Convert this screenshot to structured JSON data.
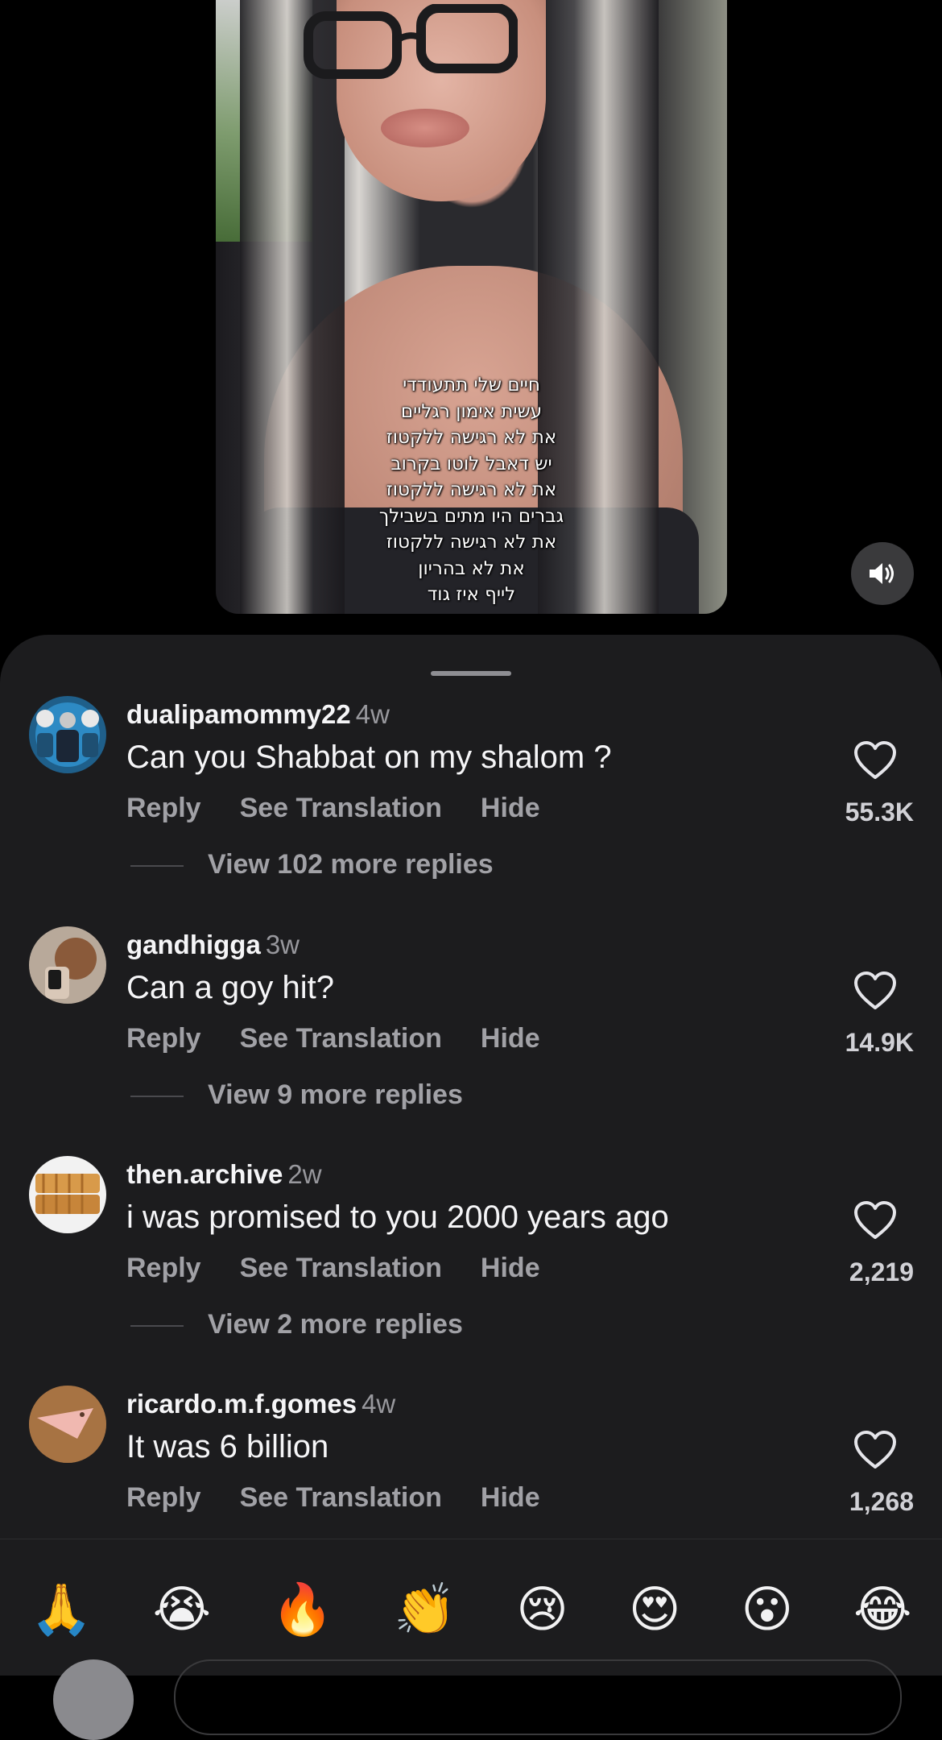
{
  "video": {
    "overlay_lines": [
      "חיים שלי תתעודדי",
      "עשית אימון רגליים",
      "את לא רגישה ללקטוז",
      "יש דאבל לוטו בקרוב",
      "את לא רגישה ללקטוז",
      "גברים היו מתים בשבילך",
      "את לא רגישה ללקטוז",
      "את לא בהריון",
      "לייף איז גוד"
    ],
    "sound_icon": "speaker-on-icon"
  },
  "comments": [
    {
      "username": "dualipamommy22",
      "age": "4w",
      "text": "Can you Shabbat on my shalom ?",
      "reply_label": "Reply",
      "translate_label": "See Translation",
      "hide_label": "Hide",
      "likes": "55.3K",
      "view_more": "View 102 more replies"
    },
    {
      "username": "gandhigga",
      "age": "3w",
      "text": "Can a goy hit?",
      "reply_label": "Reply",
      "translate_label": "See Translation",
      "hide_label": "Hide",
      "likes": "14.9K",
      "view_more": "View 9 more replies"
    },
    {
      "username": "then.archive",
      "age": "2w",
      "text": "i was promised to you 2000 years ago",
      "reply_label": "Reply",
      "translate_label": "See Translation",
      "hide_label": "Hide",
      "likes": "2,219",
      "view_more": "View 2 more replies"
    },
    {
      "username": "ricardo.m.f.gomes",
      "age": "4w",
      "text": "It was 6 billion",
      "reply_label": "Reply",
      "translate_label": "See Translation",
      "hide_label": "Hide",
      "likes": "1,268"
    }
  ],
  "emoji_bar": [
    "🙏",
    "😭",
    "🔥",
    "👏",
    "😢",
    "😍",
    "😮",
    "😂"
  ],
  "colors": {
    "sheet_bg": "#1c1c1e",
    "muted_text": "#a1a1a6",
    "primary_text": "#f5f5f7"
  }
}
